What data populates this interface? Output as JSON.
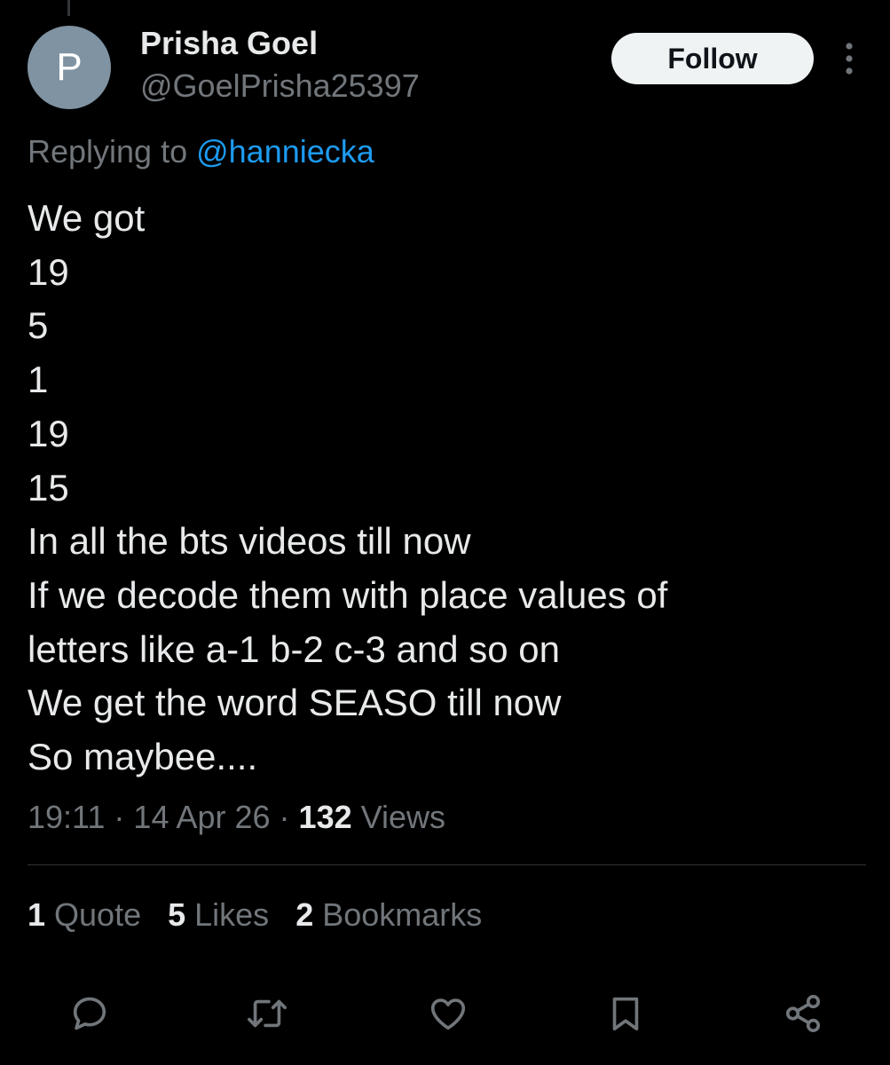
{
  "author": {
    "avatar_initial": "P",
    "display_name": "Prisha Goel",
    "handle": "@GoelPrisha25397"
  },
  "follow_label": "Follow",
  "reply": {
    "prefix": "Replying to ",
    "mention": "@hanniecka"
  },
  "tweet": {
    "lines": [
      "We got",
      "19",
      "5",
      "1",
      "19",
      "15",
      "In all the bts videos till now",
      "If we decode them with place values of",
      "letters like a-1 b-2 c-3 and so on",
      "We get the word SEASO till now",
      "So maybee...."
    ]
  },
  "meta": {
    "time": "19:11",
    "sep1": " · ",
    "date": "14 Apr 26",
    "sep2": " · ",
    "views_count": "132",
    "views_label": " Views"
  },
  "stats": {
    "quotes_count": "1",
    "quotes_label": " Quote",
    "likes_count": "5",
    "likes_label": " Likes",
    "bookmarks_count": "2",
    "bookmarks_label": " Bookmarks"
  },
  "icons": {
    "more": "more-vertical-icon",
    "reply": "reply-icon",
    "repost": "repost-icon",
    "like": "heart-icon",
    "bookmark": "bookmark-icon",
    "share": "share-icon"
  },
  "colors": {
    "background": "#000000",
    "text_primary": "#e7e9ea",
    "text_secondary": "#71767b",
    "link": "#1d9bf0",
    "avatar_bg": "#7f93a2",
    "follow_bg": "#eff3f4",
    "divider": "#2f3336"
  }
}
